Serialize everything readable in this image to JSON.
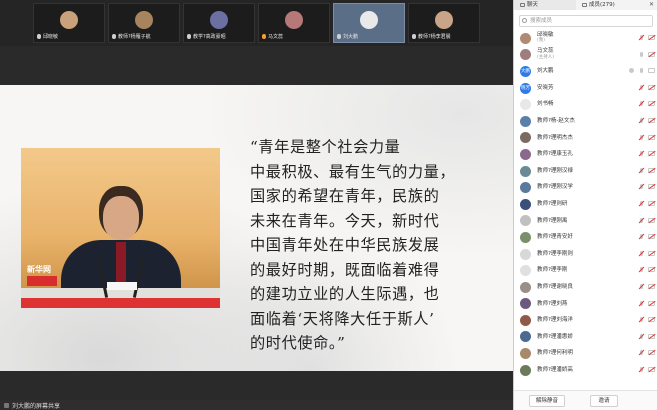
{
  "video_strip": [
    {
      "name": "邱晓敏",
      "avatar_color": "#c9a27c",
      "mic": "off"
    },
    {
      "name": "教师?杨雁子航",
      "avatar_color": "#a7845e",
      "mic": "off"
    },
    {
      "name": "教学?高政豪昭",
      "avatar_color": "#6b6fa1",
      "mic": "off"
    },
    {
      "name": "马文蕊",
      "avatar_color": "#b67878",
      "mic": "on"
    },
    {
      "name": "刘大鹏",
      "avatar_color": "#e9e9e9",
      "mic": "off",
      "active": true
    },
    {
      "name": "教师?杨李君晨",
      "avatar_color": "#caa488",
      "mic": "off"
    }
  ],
  "shared_slide": {
    "quote_lines": [
      "  “青年是整个社会力量",
      "中最积极、最有生气的力量，",
      "国家的希望在青年，民族的",
      "未来在青年。今天，新时代",
      "中国青年处在中华民族发展",
      "的最好时期，既面临着难得",
      "的建功立业的人生际遇，也",
      "面临着‘天将降大任于斯人’",
      "的时代使命。”"
    ],
    "photo_logo_text": "新华网"
  },
  "sharing_status": "刘大鹏的屏幕共享",
  "panel": {
    "tab_chat": "聊天",
    "tab_members": "成员(279)",
    "close_glyph": "✕",
    "search_placeholder": "搜索成员",
    "participants": [
      {
        "name": "邱晓敏",
        "sub": "(我)",
        "avatar_color": "#b08a73",
        "avatar_text": "",
        "mic_muted": true,
        "cam_muted": true
      },
      {
        "name": "马文蕊",
        "sub": "(主持人)",
        "avatar_color": "#9e7d7d",
        "avatar_text": "",
        "mic_muted": false,
        "cam_muted": true
      },
      {
        "name": "刘大鹏",
        "sub": "",
        "avatar_color": "#2f7be6",
        "avatar_text": "大鹏",
        "mic_muted": false,
        "cam_muted": false,
        "extra": true
      },
      {
        "name": "安晓芳",
        "sub": "",
        "avatar_color": "#2f7be6",
        "avatar_text": "晓芳",
        "mic_muted": true,
        "cam_muted": true
      },
      {
        "name": "刘书畅",
        "sub": "",
        "avatar_color": "#e8e8e8",
        "avatar_text": "",
        "mic_muted": true,
        "cam_muted": true
      },
      {
        "name": "教师?杨-赵文杰",
        "sub": "",
        "avatar_color": "#5a7fa8",
        "avatar_text": "",
        "mic_muted": true,
        "cam_muted": true
      },
      {
        "name": "教师?理明杰杰",
        "sub": "",
        "avatar_color": "#7b6a62",
        "avatar_text": "",
        "mic_muted": true,
        "cam_muted": true
      },
      {
        "name": "教师?理康玉孔",
        "sub": "",
        "avatar_color": "#8a6a8c",
        "avatar_text": "",
        "mic_muted": true,
        "cam_muted": true
      },
      {
        "name": "教师?理刚汉禄",
        "sub": "",
        "avatar_color": "#6a8a96",
        "avatar_text": "",
        "mic_muted": true,
        "cam_muted": true
      },
      {
        "name": "教师?理刚汉学",
        "sub": "",
        "avatar_color": "#597a9c",
        "avatar_text": "",
        "mic_muted": true,
        "cam_muted": true
      },
      {
        "name": "教师?理则研",
        "sub": "",
        "avatar_color": "#3a4f7a",
        "avatar_text": "",
        "mic_muted": true,
        "cam_muted": true
      },
      {
        "name": "教师?理刚禹",
        "sub": "",
        "avatar_color": "#c0c0c0",
        "avatar_text": "",
        "mic_muted": true,
        "cam_muted": true
      },
      {
        "name": "教师?理青安好",
        "sub": "",
        "avatar_color": "#7a8f6a",
        "avatar_text": "",
        "mic_muted": true,
        "cam_muted": true
      },
      {
        "name": "教师?理李刚则",
        "sub": "",
        "avatar_color": "#d8d8d8",
        "avatar_text": "",
        "mic_muted": true,
        "cam_muted": true
      },
      {
        "name": "教师?理李刚",
        "sub": "",
        "avatar_color": "#e0e0e0",
        "avatar_text": "",
        "mic_muted": true,
        "cam_muted": true
      },
      {
        "name": "教师?理谢晓良",
        "sub": "",
        "avatar_color": "#9a8f86",
        "avatar_text": "",
        "mic_muted": true,
        "cam_muted": true
      },
      {
        "name": "教师?理刘燕",
        "sub": "",
        "avatar_color": "#6a5a7e",
        "avatar_text": "",
        "mic_muted": true,
        "cam_muted": true
      },
      {
        "name": "教师?理刘海洋",
        "sub": "",
        "avatar_color": "#8f5a4a",
        "avatar_text": "",
        "mic_muted": true,
        "cam_muted": true
      },
      {
        "name": "教师?理潘惠娇",
        "sub": "",
        "avatar_color": "#4a6a8f",
        "avatar_text": "",
        "mic_muted": true,
        "cam_muted": true
      },
      {
        "name": "教师?理何利明",
        "sub": "",
        "avatar_color": "#a88a6a",
        "avatar_text": "",
        "mic_muted": true,
        "cam_muted": true
      },
      {
        "name": "教师?理潘娇高",
        "sub": "",
        "avatar_color": "#6a7a5a",
        "avatar_text": "",
        "mic_muted": true,
        "cam_muted": true
      }
    ],
    "btn_unmute_all": "解除静音",
    "btn_invite": "邀请"
  }
}
